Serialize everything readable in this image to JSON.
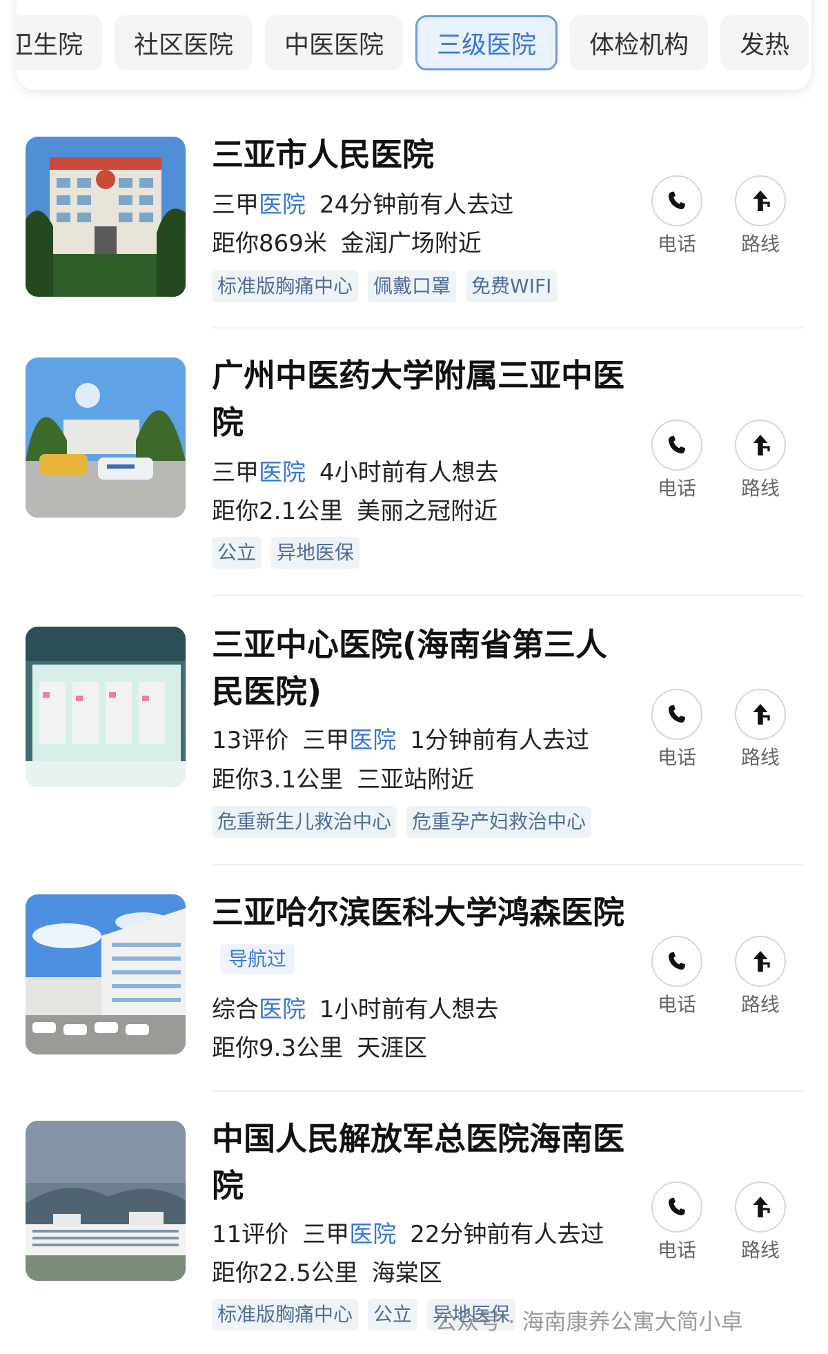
{
  "filters": [
    {
      "label": "卫生院",
      "active": false
    },
    {
      "label": "社区医院",
      "active": false
    },
    {
      "label": "中医医院",
      "active": false
    },
    {
      "label": "三级医院",
      "active": true
    },
    {
      "label": "体检机构",
      "active": false
    },
    {
      "label": "发热",
      "active": false
    }
  ],
  "actions": {
    "call": "电话",
    "route": "路线"
  },
  "hospitals": [
    {
      "name": "三亚市人民医院",
      "badge": "",
      "level": "三甲",
      "category": "医院",
      "activity": "24分钟前有人去过",
      "distance": "距你869米",
      "area": "金润广场附近",
      "reviews": "",
      "tags": [
        "标准版胸痛中心",
        "佩戴口罩",
        "免费WIFI"
      ]
    },
    {
      "name": "广州中医药大学附属三亚中医院",
      "badge": "",
      "level": "三甲",
      "category": "医院",
      "activity": "4小时前有人想去",
      "distance": "距你2.1公里",
      "area": "美丽之冠附近",
      "reviews": "",
      "tags": [
        "公立",
        "异地医保"
      ]
    },
    {
      "name": "三亚中心医院(海南省第三人民医院)",
      "badge": "",
      "level": "三甲",
      "category": "医院",
      "activity": "1分钟前有人去过",
      "distance": "距你3.1公里",
      "area": "三亚站附近",
      "reviews": "13评价",
      "tags": [
        "危重新生儿救治中心",
        "危重孕产妇救治中心"
      ]
    },
    {
      "name": "三亚哈尔滨医科大学鸿森医院",
      "badge": "导航过",
      "level": "综合",
      "category": "医院",
      "activity": "1小时前有人想去",
      "distance": "距你9.3公里",
      "area": "天涯区",
      "reviews": "",
      "tags": []
    },
    {
      "name": "中国人民解放军总医院海南医院",
      "badge": "",
      "level": "三甲",
      "category": "医院",
      "activity": "22分钟前有人去过",
      "distance": "距你22.5公里",
      "area": "海棠区",
      "reviews": "11评价",
      "tags": [
        "标准版胸痛中心",
        "公立",
        "异地医保"
      ]
    }
  ],
  "watermark": "公众号 · 海南康养公寓大简小卓"
}
